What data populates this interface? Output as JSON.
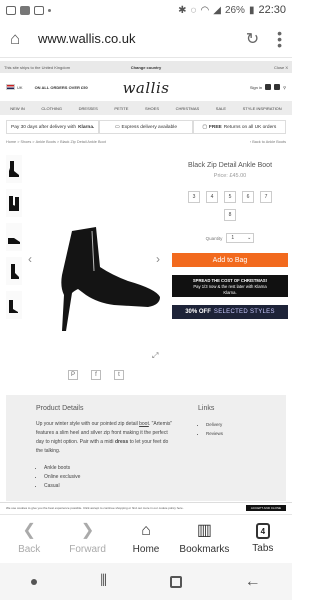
{
  "status_bar": {
    "battery": "26%",
    "time": "22:30"
  },
  "browser": {
    "url": "www.wallis.co.uk",
    "menu_label": "⋮"
  },
  "ship_bar": {
    "left": "This site ships to the United Kingdom",
    "center": "Change country",
    "right": "Close X"
  },
  "header": {
    "region": "UK",
    "free_order": "ON ALL ORDERS OVER £50",
    "logo": "wallis",
    "sign_in": "Sign in"
  },
  "nav": [
    "NEW IN",
    "CLOTHING",
    "DRESSES",
    "PETITE",
    "SHOES",
    "CHRISTMAS",
    "SALE",
    "STYLE INSPIRATION"
  ],
  "promo": {
    "pay30": "Pay 30 days after delivery with",
    "klarna": "Klarna.",
    "express": "Express delivery available",
    "free_returns_bold": "FREE",
    "free_returns": "Returns on all UK orders"
  },
  "breadcrumbs": {
    "path": [
      "Home",
      "Shoes",
      "Ankle Boots",
      "Black Zip Detail Ankle Boot"
    ],
    "back": "Back to Ankle Boots"
  },
  "product": {
    "title": "Black Zip Detail Ankle Boot",
    "price": "Price: £45.00",
    "sizes": [
      "3",
      "4",
      "5",
      "6",
      "7",
      "8"
    ],
    "quantity_label": "Quantity",
    "quantity_value": "1",
    "add_to_bag": "Add to Bag"
  },
  "xmas_banner": {
    "heading": "SPREAD THE COST OF CHRISTMAS!",
    "text": "Pay 1/3 now & the rest later with Klarna",
    "brand": "Klarna."
  },
  "off_banner": {
    "bold": "30% OFF",
    "rest": "SELECTED STYLES"
  },
  "share": [
    "P",
    "f",
    "t"
  ],
  "details": {
    "heading": "Product Details",
    "body_1": "Up your winter style with our pointed zip detail ",
    "body_link_1": "boot",
    "body_2": ". \"Artemis\" features a slim heel and silver zip front making it the perfect day to night option. Pair with a midi ",
    "body_link_2": "dress",
    "body_3": " to let your feet do the talking.",
    "bullets": [
      "Ankle boots",
      "Online exclusive",
      "Casual"
    ],
    "links_heading": "Links",
    "links": [
      "Delivery",
      "Reviews"
    ]
  },
  "cookie": {
    "text": "We use cookies to give you the best experience possible. Click accept to continue shopping or find out more in our cookie policy here.",
    "accept": "ACCEPT AND CLOSE"
  },
  "toolbar": {
    "back": "Back",
    "forward": "Forward",
    "home": "Home",
    "bookmarks": "Bookmarks",
    "tabs": "Tabs",
    "tab_count": "4"
  }
}
